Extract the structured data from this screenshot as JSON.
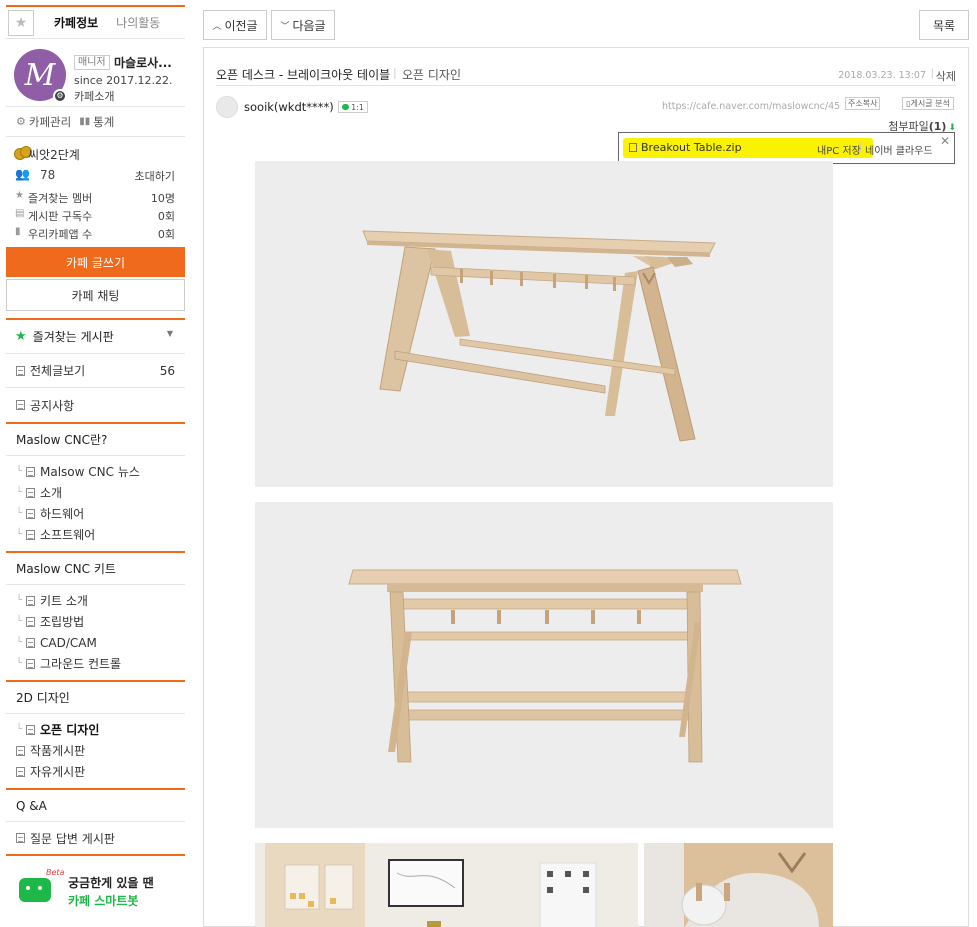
{
  "sidebar": {
    "tab_active": "카페정보",
    "tab_other": "나의활동",
    "profile": {
      "badge": "매니저",
      "name": "마슬로사...",
      "since": "since 2017.12.22.",
      "intro": "카페소개"
    },
    "mgmt": {
      "manage": "카페관리",
      "stats": "통계"
    },
    "level": "씨앗2단계",
    "members": {
      "count": "78",
      "invite": "초대하기"
    },
    "stat_rows": [
      {
        "label": "즐겨찾는 멤버",
        "value": "10명"
      },
      {
        "label": "게시판 구독수",
        "value": "0회"
      },
      {
        "label": "우리카페앱 수",
        "value": "0회"
      }
    ],
    "write_button": "카페 글쓰기",
    "chat_button": "카페 채팅",
    "fav_board": "즐겨찾는 게시판",
    "all_posts": {
      "label": "전체글보기",
      "count": "56"
    },
    "notice": "공지사항",
    "groups": [
      {
        "title": "Maslow CNC란?",
        "items": [
          "Malsow CNC 뉴스",
          "소개",
          "하드웨어",
          "소프트웨어"
        ]
      },
      {
        "title": "Maslow CNC 키트",
        "items": [
          "키트 소개",
          "조립방법",
          "CAD/CAM",
          "그라운드 컨트롤"
        ]
      },
      {
        "title": "2D 디자인",
        "items": [
          "오픈 디자인",
          "작품게시판",
          "자유게시판"
        ]
      },
      {
        "title": "Q &A",
        "items": [
          "질문 답변 게시판"
        ]
      }
    ],
    "bot": {
      "beta": "Beta",
      "line1": "궁금한게 있을 땐",
      "line2": "카페 스마트봇"
    }
  },
  "topbar": {
    "prev": "이전글",
    "next": "다음글",
    "list": "목록"
  },
  "post": {
    "title": "오픈 데스크 - 브레이크아웃 테이블",
    "category": "오픈 디자인",
    "date": "2018.03.23. 13:07",
    "delete": "삭제",
    "author": "sooik(wkdt****)",
    "chat_badge": "1:1",
    "url": "https://cafe.naver.com/maslowcnc/45",
    "addr_button": "주소복사",
    "analysis_button": "게시글 분석",
    "attach_label": "첨부파일",
    "attach_count": "(1)",
    "attach_file": "Breakout Table.zip",
    "attach_pc": "내PC 저장",
    "attach_cloud": "네이버 클라우드"
  },
  "colors": {
    "accent": "#ef6a1c",
    "green": "#1db847",
    "highlight": "#faf200"
  }
}
